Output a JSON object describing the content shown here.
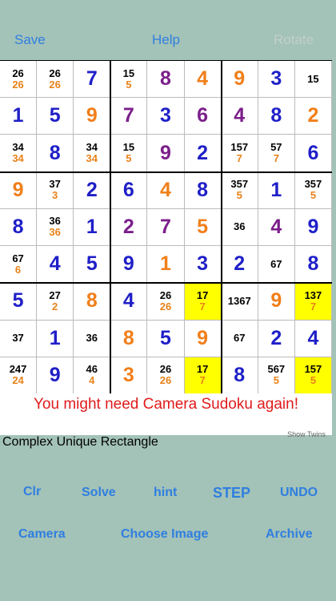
{
  "toolbar": {
    "save": "Save",
    "help": "Help",
    "rotate": "Rotate"
  },
  "grid": [
    [
      {
        "c": [
          "26",
          "26"
        ]
      },
      {
        "c": [
          "26",
          "26"
        ]
      },
      {
        "v": "7",
        "col": "#1f1fc8"
      },
      {
        "c": [
          "15",
          "5"
        ]
      },
      {
        "v": "8",
        "col": "#7b1f8a"
      },
      {
        "v": "4",
        "col": "#f07f1a"
      },
      {
        "v": "9",
        "col": "#f07f1a"
      },
      {
        "v": "3",
        "col": "#1f1fc8"
      },
      {
        "c": [
          "15"
        ]
      }
    ],
    [
      {
        "v": "1",
        "col": "#1f1fc8"
      },
      {
        "v": "5",
        "col": "#1f1fc8"
      },
      {
        "v": "9",
        "col": "#f07f1a"
      },
      {
        "v": "7",
        "col": "#7b1f8a"
      },
      {
        "v": "3",
        "col": "#1f1fc8"
      },
      {
        "v": "6",
        "col": "#7b1f8a"
      },
      {
        "v": "4",
        "col": "#7b1f8a"
      },
      {
        "v": "8",
        "col": "#1f1fc8"
      },
      {
        "v": "2",
        "col": "#f07f1a"
      }
    ],
    [
      {
        "c": [
          "34",
          "34"
        ]
      },
      {
        "v": "8",
        "col": "#1f1fc8"
      },
      {
        "c": [
          "34",
          "34"
        ]
      },
      {
        "c": [
          "15",
          "5"
        ]
      },
      {
        "v": "9",
        "col": "#7b1f8a"
      },
      {
        "v": "2",
        "col": "#1f1fc8"
      },
      {
        "c": [
          "157",
          "7"
        ]
      },
      {
        "c": [
          "57",
          "7"
        ]
      },
      {
        "v": "6",
        "col": "#1f1fc8"
      }
    ],
    [
      {
        "v": "9",
        "col": "#f07f1a"
      },
      {
        "c": [
          "37",
          "3"
        ]
      },
      {
        "v": "2",
        "col": "#1f1fc8"
      },
      {
        "v": "6",
        "col": "#1f1fc8"
      },
      {
        "v": "4",
        "col": "#f07f1a"
      },
      {
        "v": "8",
        "col": "#1f1fc8"
      },
      {
        "c": [
          "357",
          "5"
        ]
      },
      {
        "v": "1",
        "col": "#1f1fc8"
      },
      {
        "c": [
          "357",
          "5"
        ]
      }
    ],
    [
      {
        "v": "8",
        "col": "#1f1fc8"
      },
      {
        "c": [
          "36",
          "36"
        ]
      },
      {
        "v": "1",
        "col": "#1f1fc8"
      },
      {
        "v": "2",
        "col": "#7b1f8a"
      },
      {
        "v": "7",
        "col": "#7b1f8a"
      },
      {
        "v": "5",
        "col": "#f07f1a"
      },
      {
        "c": [
          "36"
        ]
      },
      {
        "v": "4",
        "col": "#7b1f8a"
      },
      {
        "v": "9",
        "col": "#1f1fc8"
      }
    ],
    [
      {
        "c": [
          "67",
          "6"
        ]
      },
      {
        "v": "4",
        "col": "#1f1fc8"
      },
      {
        "v": "5",
        "col": "#1f1fc8"
      },
      {
        "v": "9",
        "col": "#1f1fc8"
      },
      {
        "v": "1",
        "col": "#f07f1a"
      },
      {
        "v": "3",
        "col": "#1f1fc8"
      },
      {
        "v": "2",
        "col": "#1f1fc8"
      },
      {
        "c": [
          "67"
        ]
      },
      {
        "v": "8",
        "col": "#1f1fc8"
      }
    ],
    [
      {
        "v": "5",
        "col": "#1f1fc8"
      },
      {
        "c": [
          "27",
          "2"
        ]
      },
      {
        "v": "8",
        "col": "#f07f1a"
      },
      {
        "v": "4",
        "col": "#1f1fc8"
      },
      {
        "c": [
          "26",
          "26"
        ]
      },
      {
        "c": [
          "17",
          "7"
        ],
        "hl": true
      },
      {
        "c": [
          "1367"
        ]
      },
      {
        "v": "9",
        "col": "#f07f1a"
      },
      {
        "c": [
          "137",
          "7"
        ],
        "hl": true
      }
    ],
    [
      {
        "c": [
          "37"
        ]
      },
      {
        "v": "1",
        "col": "#1f1fc8"
      },
      {
        "c": [
          "36"
        ]
      },
      {
        "v": "8",
        "col": "#f07f1a"
      },
      {
        "v": "5",
        "col": "#1f1fc8"
      },
      {
        "v": "9",
        "col": "#f07f1a"
      },
      {
        "c": [
          "67"
        ]
      },
      {
        "v": "2",
        "col": "#1f1fc8"
      },
      {
        "v": "4",
        "col": "#1f1fc8"
      }
    ],
    [
      {
        "c": [
          "247",
          "24"
        ]
      },
      {
        "v": "9",
        "col": "#1f1fc8"
      },
      {
        "c": [
          "46",
          "4"
        ]
      },
      {
        "v": "3",
        "col": "#f07f1a"
      },
      {
        "c": [
          "26",
          "26"
        ]
      },
      {
        "c": [
          "17",
          "7"
        ],
        "hl": true
      },
      {
        "v": "8",
        "col": "#1f1fc8"
      },
      {
        "c": [
          "567",
          "5"
        ]
      },
      {
        "c": [
          "157",
          "5"
        ],
        "hl": true
      }
    ]
  ],
  "message": "You might need Camera Sudoku again!",
  "show_twins": "Show Twins",
  "technique": "Complex Unique Rectangle",
  "buttons": {
    "clr": "Clr",
    "solve": "Solve",
    "hint": "hint",
    "step": "STEP",
    "undo": "UNDO",
    "camera": "Camera",
    "choose_image": "Choose Image",
    "archive": "Archive"
  }
}
